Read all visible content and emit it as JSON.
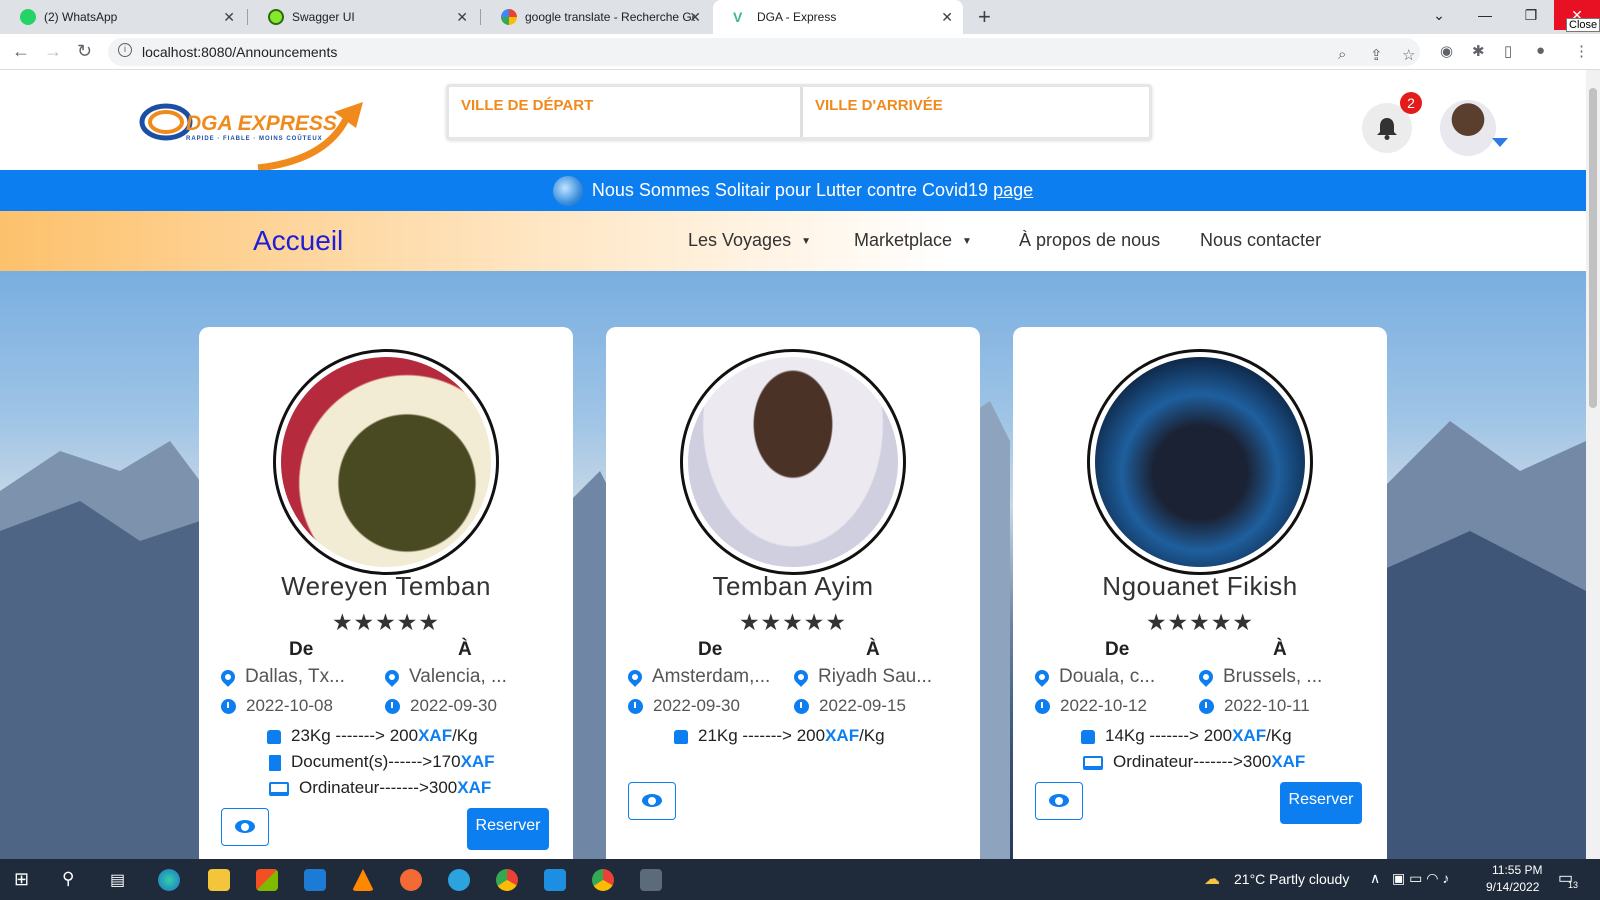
{
  "browser": {
    "tabs": [
      {
        "title": "(2) WhatsApp",
        "favicon": "whatsapp-icon",
        "color": "#25d366"
      },
      {
        "title": "Swagger UI",
        "favicon": "swagger-icon",
        "color": "#85ea2d"
      },
      {
        "title": "google translate - Recherche Goo",
        "favicon": "google-icon",
        "color": "#4285f4"
      },
      {
        "title": "DGA - Express",
        "favicon": "vue-icon",
        "color": "#41b883"
      }
    ],
    "new_tab": "+",
    "url": "localhost:8080/Announcements",
    "close_tooltip": "Close"
  },
  "header": {
    "logo_text": "DGA EXPRESS",
    "logo_tagline": "RAPIDE · FIABLE · MOINS COÛTEUX",
    "departure_placeholder": "VILLE DE DÉPART",
    "arrival_placeholder": "VILLE D'ARRIVÉE",
    "notification_count": "2"
  },
  "banner": {
    "text": "Nous Sommes Solitair pour Lutter contre Covid19",
    "link": "page"
  },
  "nav": {
    "home": "Accueil",
    "items": [
      "Les Voyages",
      "Marketplace",
      "À propos de nous",
      "Nous contacter"
    ]
  },
  "labels": {
    "from": "De",
    "to": "À",
    "stars": "★★★★★",
    "reserve": "Reserver"
  },
  "cards": [
    {
      "name": "Wereyen Temban",
      "from_city": "Dallas, Tx...",
      "to_city": "Valencia, ...",
      "from_date": "2022-10-08",
      "to_date": "2022-09-30",
      "weight": "23Kg -------> 200",
      "doc": "Document(s)------>170",
      "pc": "Ordinateur------->300",
      "currency": "XAF",
      "per_kg": "/Kg",
      "has_reserve": true
    },
    {
      "name": "Temban Ayim",
      "from_city": "Amsterdam,...",
      "to_city": "Riyadh Sau...",
      "from_date": "2022-09-30",
      "to_date": "2022-09-15",
      "weight": "21Kg -------> 200",
      "currency": "XAF",
      "per_kg": "/Kg",
      "has_reserve": false
    },
    {
      "name": "Ngouanet Fikish",
      "from_city": "Douala, c...",
      "to_city": "Brussels, ...",
      "from_date": "2022-10-12",
      "to_date": "2022-10-11",
      "weight": "14Kg -------> 200",
      "pc": "Ordinateur------->300",
      "currency": "XAF",
      "per_kg": "/Kg",
      "has_reserve": true
    }
  ],
  "taskbar": {
    "weather": "21°C  Partly cloudy",
    "time": "11:55 PM",
    "date": "9/14/2022",
    "notifications": "13"
  },
  "colors": {
    "accent": "#0d7ef0",
    "brand_orange": "#f08a1d",
    "home_link": "#1d1ed8"
  }
}
